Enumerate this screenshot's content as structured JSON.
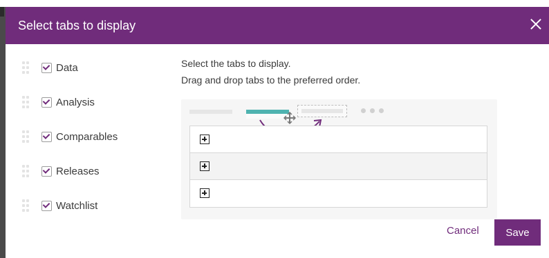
{
  "dialog": {
    "title": "Select tabs to display",
    "instruction_line1": "Select the tabs to display.",
    "instruction_line2": "Drag and drop tabs to the preferred order."
  },
  "tabs": [
    {
      "label": "Data",
      "checked": true
    },
    {
      "label": "Analysis",
      "checked": true
    },
    {
      "label": "Comparables",
      "checked": true
    },
    {
      "label": "Releases",
      "checked": true
    },
    {
      "label": "Watchlist",
      "checked": true
    }
  ],
  "actions": {
    "cancel_label": "Cancel",
    "save_label": "Save"
  },
  "icons": {
    "close": "close-icon",
    "drag": "drag-handle-icon",
    "check": "checkbox-checked-icon",
    "move": "move-cursor-icon",
    "expand": "plus-square-icon"
  },
  "colors": {
    "brand": "#702c7b",
    "accent_teal": "#4fb3b0"
  }
}
